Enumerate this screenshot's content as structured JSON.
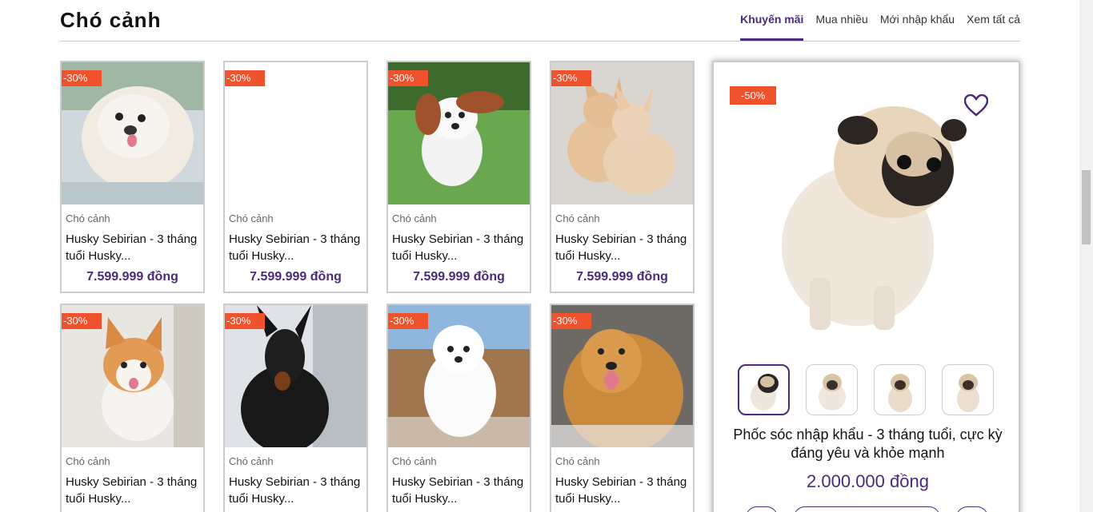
{
  "section": {
    "title": "Chó cảnh",
    "tabs": [
      "Khuyến mãi",
      "Mua nhiều",
      "Mới nhập khẩu",
      "Xem tất cả"
    ]
  },
  "products": [
    {
      "badge": "-30%",
      "category": "Chó cảnh",
      "name": "Husky Sebirian - 3 tháng tuổi Husky...",
      "price": "7.599.999 đồng",
      "image": "pekingese-white-dog"
    },
    {
      "badge": "-30%",
      "category": "Chó cảnh",
      "name": "Husky Sebirian - 3 tháng tuổi Husky...",
      "price": "7.599.999 đồng",
      "image": "blank"
    },
    {
      "badge": "-30%",
      "category": "Chó cảnh",
      "name": "Husky Sebirian - 3 tháng tuổi Husky...",
      "price": "7.599.999 đồng",
      "image": "cavalier-puppy-grass"
    },
    {
      "badge": "-30%",
      "category": "Chó cảnh",
      "name": "Husky Sebirian - 3 tháng tuổi Husky...",
      "price": "7.599.999 đồng",
      "image": "chihuahua-pair"
    },
    {
      "badge": "-30%",
      "category": "Chó cảnh",
      "name": "Husky Sebirian - 3 tháng tuổi Husky...",
      "price": "",
      "image": "corgi-puppy"
    },
    {
      "badge": "-30%",
      "category": "Chó cảnh",
      "name": "Husky Sebirian - 3 tháng tuổi Husky...",
      "price": "",
      "image": "doberman"
    },
    {
      "badge": "-30%",
      "category": "Chó cảnh",
      "name": "Husky Sebirian - 3 tháng tuổi Husky...",
      "price": "",
      "image": "samoyed-puppy"
    },
    {
      "badge": "-30%",
      "category": "Chó cảnh",
      "name": "Husky Sebirian - 3 tháng tuổi Husky...",
      "price": "",
      "image": "golden-retriever"
    }
  ],
  "featured": {
    "badge": "-50%",
    "name": "Phốc sóc nhập khẩu - 3 tháng tuổi, cực kỳ đáng yêu và khỏe mạnh",
    "price": "2.000.000 đồng",
    "icons": [
      "heart-icon"
    ],
    "thumbnails": [
      "pug-thumb-1",
      "pug-thumb-2",
      "pug-thumb-3",
      "pug-thumb-4"
    ]
  },
  "colors": {
    "accent": "#4a2a7a",
    "badge": "#f0522d"
  }
}
